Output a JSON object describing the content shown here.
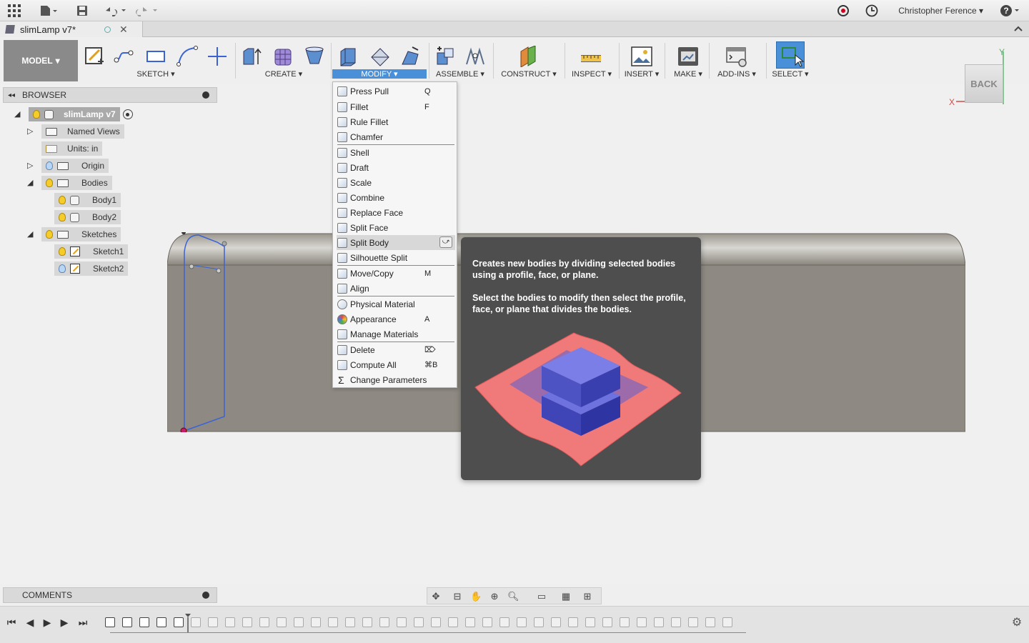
{
  "appbar": {
    "user_name": "Christopher Ference",
    "help_label": "?"
  },
  "document": {
    "tab_title": "slimLamp v7*"
  },
  "toolbar": {
    "workspace": "MODEL",
    "groups": [
      {
        "label": "SKETCH"
      },
      {
        "label": "CREATE"
      },
      {
        "label": "MODIFY"
      },
      {
        "label": "ASSEMBLE"
      },
      {
        "label": "CONSTRUCT"
      },
      {
        "label": "INSPECT"
      },
      {
        "label": "INSERT"
      },
      {
        "label": "MAKE"
      },
      {
        "label": "ADD-INS"
      },
      {
        "label": "SELECT"
      }
    ]
  },
  "browser": {
    "title": "BROWSER",
    "root": "slimLamp v7",
    "items": [
      {
        "label": "Named Views"
      },
      {
        "label": "Units: in"
      },
      {
        "label": "Origin"
      },
      {
        "label": "Bodies"
      },
      {
        "label": "Body1"
      },
      {
        "label": "Body2"
      },
      {
        "label": "Sketches"
      },
      {
        "label": "Sketch1"
      },
      {
        "label": "Sketch2"
      }
    ]
  },
  "viewcube": {
    "face": "BACK",
    "axis_x": "X",
    "axis_y": "Y"
  },
  "modify_menu": {
    "items": [
      {
        "label": "Press Pull",
        "shortcut": "Q"
      },
      {
        "label": "Fillet",
        "shortcut": "F"
      },
      {
        "label": "Rule Fillet",
        "shortcut": ""
      },
      {
        "label": "Chamfer",
        "shortcut": ""
      },
      {
        "label": "Shell",
        "shortcut": ""
      },
      {
        "label": "Draft",
        "shortcut": ""
      },
      {
        "label": "Scale",
        "shortcut": ""
      },
      {
        "label": "Combine",
        "shortcut": ""
      },
      {
        "label": "Replace Face",
        "shortcut": ""
      },
      {
        "label": "Split Face",
        "shortcut": ""
      },
      {
        "label": "Split Body",
        "shortcut": ""
      },
      {
        "label": "Silhouette Split",
        "shortcut": ""
      },
      {
        "label": "Move/Copy",
        "shortcut": "M"
      },
      {
        "label": "Align",
        "shortcut": ""
      },
      {
        "label": "Physical Material",
        "shortcut": ""
      },
      {
        "label": "Appearance",
        "shortcut": "A"
      },
      {
        "label": "Manage Materials",
        "shortcut": ""
      },
      {
        "label": "Delete",
        "shortcut": "⌦"
      },
      {
        "label": "Compute All",
        "shortcut": "⌘B"
      },
      {
        "label": "Change Parameters",
        "shortcut": ""
      }
    ]
  },
  "tooltip": {
    "line1": "Creates new bodies by dividing selected bodies using a profile, face, or plane.",
    "line2": "Select the bodies to modify then select the profile, face, or plane that divides the bodies."
  },
  "comments": {
    "title": "COMMENTS"
  },
  "colors": {
    "accent": "#4a90d9",
    "sketch_line": "#3b63d6",
    "tooltip_bg": "#4e4e4e"
  }
}
